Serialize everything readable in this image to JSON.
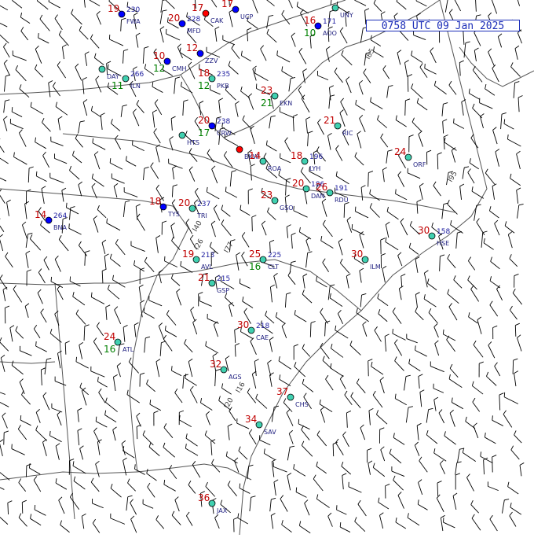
{
  "map": {
    "timestamp": "0758 UTC 09 Jan 2025",
    "colors": {
      "border": "#555555",
      "temp": "#c00000",
      "dew": "#008000",
      "station": "#202080",
      "pressure": "#2020a0",
      "wx_snow": "#800080",
      "blue_station": "#0000ff",
      "red_station": "#ff0000",
      "barb": "#000000",
      "cyan_station": "#40d0b0"
    },
    "route_labels": [
      "I85",
      "I95",
      "I77",
      "I40",
      "I26",
      "I20",
      "I16"
    ],
    "stations": [
      {
        "id": "UNY",
        "temp": "",
        "dew": "",
        "pres": "",
        "color": "cyan"
      },
      {
        "id": "AOO",
        "temp": "16",
        "dew": "10",
        "pres": "171",
        "color": "blue"
      },
      {
        "id": "CAK",
        "temp": "17",
        "dew": "",
        "pres": "",
        "color": "red"
      },
      {
        "id": "UCP",
        "temp": "17",
        "dew": "",
        "pres": "",
        "color": "blue"
      },
      {
        "id": "MFD",
        "temp": "20",
        "dew": "",
        "pres": "228",
        "color": "blue"
      },
      {
        "id": "FWA",
        "temp": "19",
        "dew": "",
        "pres": "230",
        "color": "blue"
      },
      {
        "id": "ZZV",
        "temp": "12",
        "dew": "",
        "pres": "",
        "color": "blue"
      },
      {
        "id": "CMH",
        "temp": "10",
        "dew": "12",
        "pres": "",
        "color": "blue"
      },
      {
        "id": "ILN",
        "temp": "",
        "dew": "11",
        "pres": "266",
        "color": "cyan"
      },
      {
        "id": "DAY",
        "temp": "",
        "dew": "",
        "pres": "",
        "color": "cyan"
      },
      {
        "id": "PKB",
        "temp": "18",
        "dew": "12",
        "pres": "235",
        "color": "cyan"
      },
      {
        "id": "EKN",
        "temp": "23",
        "dew": "21",
        "pres": "",
        "color": "cyan"
      },
      {
        "id": "CRW",
        "temp": "20",
        "dew": "17",
        "pres": "238",
        "color": "blue"
      },
      {
        "id": "HTS",
        "temp": "",
        "dew": "",
        "pres": "",
        "color": "cyan"
      },
      {
        "id": "BKW",
        "temp": "",
        "dew": "",
        "pres": "",
        "color": "red"
      },
      {
        "id": "ROA",
        "temp": "14",
        "dew": "",
        "pres": "",
        "color": "cyan"
      },
      {
        "id": "LYH",
        "temp": "18",
        "dew": "",
        "pres": "196",
        "color": "cyan"
      },
      {
        "id": "DAN",
        "temp": "20",
        "dew": "",
        "pres": "186",
        "color": "cyan"
      },
      {
        "id": "GSO",
        "temp": "23",
        "dew": "",
        "pres": "",
        "color": "cyan"
      },
      {
        "id": "RDU",
        "temp": "26",
        "dew": "",
        "pres": "191",
        "color": "cyan"
      },
      {
        "id": "CLT",
        "temp": "25",
        "dew": "16",
        "pres": "225",
        "color": "cyan"
      },
      {
        "id": "GSP",
        "temp": "21",
        "dew": "",
        "pres": "215",
        "color": "cyan"
      },
      {
        "id": "AVL",
        "temp": "19",
        "dew": "",
        "pres": "213",
        "color": "cyan"
      },
      {
        "id": "TRI",
        "temp": "20",
        "dew": "",
        "pres": "237",
        "color": "cyan"
      },
      {
        "id": "TYS",
        "temp": "18",
        "dew": "",
        "pres": "",
        "color": "blue"
      },
      {
        "id": "BNA",
        "temp": "14",
        "dew": "",
        "pres": "264",
        "color": "blue"
      },
      {
        "id": "ATL",
        "temp": "24",
        "dew": "16",
        "pres": "",
        "color": "cyan"
      },
      {
        "id": "AGS",
        "temp": "32",
        "dew": "",
        "pres": "",
        "color": "cyan"
      },
      {
        "id": "CAE",
        "temp": "30",
        "dew": "",
        "pres": "218",
        "color": "cyan"
      },
      {
        "id": "CHS",
        "temp": "37",
        "dew": "",
        "pres": "",
        "color": "cyan"
      },
      {
        "id": "SAV",
        "temp": "34",
        "dew": "",
        "pres": "",
        "color": "cyan"
      },
      {
        "id": "JAX",
        "temp": "36",
        "dew": "",
        "pres": "",
        "color": "cyan"
      },
      {
        "id": "ILM",
        "temp": "30",
        "dew": "",
        "pres": "",
        "color": "cyan"
      },
      {
        "id": "HSE",
        "temp": "30",
        "dew": "",
        "pres": "158",
        "color": "cyan"
      },
      {
        "id": "ORF",
        "temp": "24",
        "dew": "",
        "pres": "",
        "color": "cyan"
      },
      {
        "id": "RIC",
        "temp": "21",
        "dew": "",
        "pres": "",
        "color": "cyan"
      }
    ]
  }
}
